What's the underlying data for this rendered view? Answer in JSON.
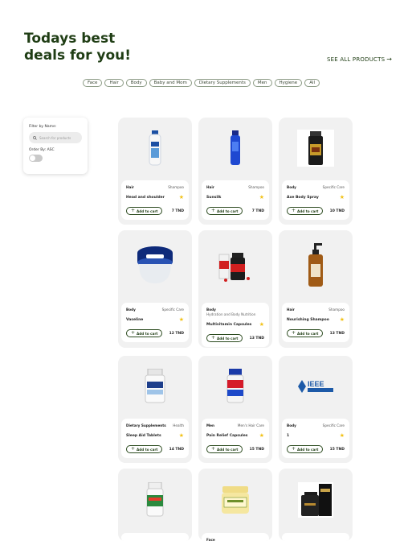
{
  "headline": "Todays best deals for you!",
  "see_all": {
    "label": "SEE ALL PRODUCTS",
    "arrow": "→"
  },
  "chips": [
    "Face",
    "Hair",
    "Body",
    "Baby and Mom",
    "Dietary Supplements",
    "Men",
    "Hygiene",
    "All"
  ],
  "filter": {
    "name_label": "Filter by Name:",
    "search_placeholder": "Search for products",
    "order_label": "Order By: ASC",
    "order_asc_enabled": false
  },
  "add_label": "Add to cart",
  "products": [
    {
      "category": "Hair",
      "type": "Shampoo",
      "subtitle": "",
      "name": "Head and shoulder",
      "price": "7 TND",
      "image": "white-blue-shampoo-bottle",
      "starred": true
    },
    {
      "category": "Hair",
      "type": "Shampoo",
      "subtitle": "",
      "name": "Sunsilk",
      "price": "7 TND",
      "image": "blue-shampoo-bottle",
      "starred": true
    },
    {
      "category": "Body",
      "type": "Specific Care",
      "subtitle": "",
      "name": "Axe Body Spray",
      "price": "10 TND",
      "image": "black-body-spray-can",
      "starred": true
    },
    {
      "category": "Body",
      "type": "Specific Care",
      "subtitle": "",
      "name": "Vaseline",
      "price": "12 TND",
      "image": "blue-petroleum-jelly-jar",
      "starred": true
    },
    {
      "category": "Body",
      "type": "",
      "subtitle": "Hydration and Body Nutrition",
      "name": "Multivitamin Capsules",
      "price": "13 TND",
      "image": "red-supplement-bottles",
      "starred": true
    },
    {
      "category": "Hair",
      "type": "Shampoo",
      "subtitle": "",
      "name": "Nourishing Shampoo",
      "price": "13 TND",
      "image": "amber-pump-bottle",
      "starred": true
    },
    {
      "category": "Dietary Supplements",
      "type": "Health",
      "subtitle": "",
      "name": "Sleep Aid Tablets",
      "price": "14 TND",
      "image": "white-pill-bottle",
      "starred": true
    },
    {
      "category": "Men",
      "type": "Men's Hair Care",
      "subtitle": "",
      "name": "Pain Relief Capsules",
      "price": "15 TND",
      "image": "blue-red-pill-bottle",
      "starred": true
    },
    {
      "category": "Body",
      "type": "Specific Care",
      "subtitle": "",
      "name": "1",
      "price": "15 TND",
      "image": "ieee-logo",
      "logo_text": "IEEE",
      "starred": true
    },
    {
      "category": "",
      "type": "",
      "subtitle": "",
      "name": "",
      "price": "",
      "image": "green-label-pill-bottle",
      "starred": false
    },
    {
      "category": "Face",
      "type": "",
      "subtitle": "",
      "name": "",
      "price": "",
      "image": "yellow-cream-jar",
      "starred": false
    },
    {
      "category": "",
      "type": "",
      "subtitle": "",
      "name": "",
      "price": "",
      "image": "black-perfume-box",
      "starred": false
    }
  ],
  "colors": {
    "brand": "#1f3d14",
    "star": "#f2c218",
    "card_bg": "#f1f1f1"
  }
}
